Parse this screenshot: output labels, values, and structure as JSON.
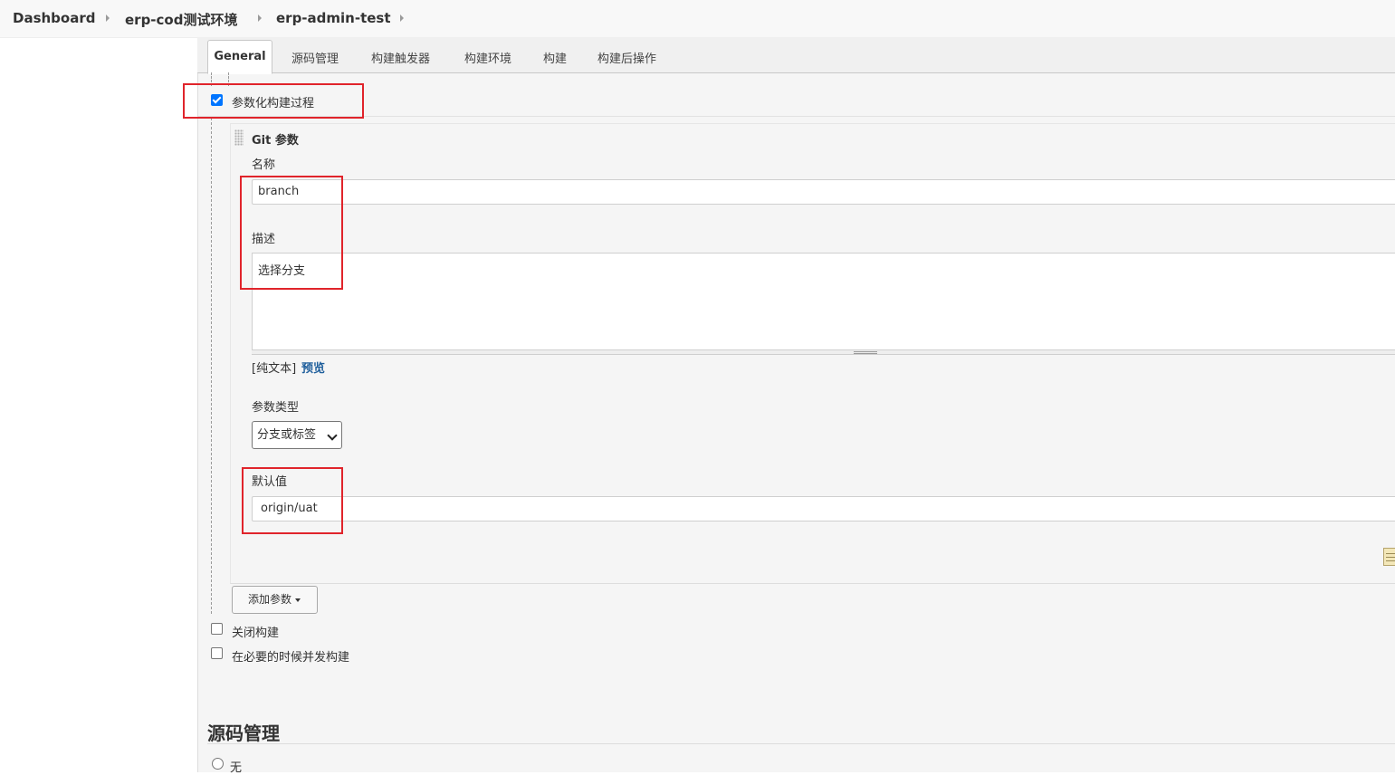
{
  "breadcrumb": {
    "items": [
      "Dashboard",
      "erp-cod测试环境",
      "erp-admin-test"
    ]
  },
  "tabs": {
    "active": "General",
    "items": [
      "源码管理",
      "构建触发器",
      "构建环境",
      "构建",
      "构建后操作"
    ]
  },
  "general": {
    "parameterized_label": "参数化构建过程",
    "parameterized_checked": true,
    "git_param": {
      "title": "Git 参数",
      "name_label": "名称",
      "name_value": "branch",
      "description_label": "描述",
      "description_value": "选择分支",
      "plain_text_label": "[纯文本]",
      "preview_label": "预览",
      "type_label": "参数类型",
      "type_value": "分支或标签",
      "default_label": "默认值",
      "default_value": "origin/uat"
    },
    "add_param_label": "添加参数",
    "disable_build_label": "关闭构建",
    "disable_build_checked": false,
    "concurrent_build_label": "在必要的时候并发构建",
    "concurrent_build_checked": false
  },
  "scm": {
    "heading": "源码管理",
    "none_label": "无"
  },
  "colors": {
    "highlight_box": "#e0242b",
    "checkbox_checked": "#0075ff",
    "link": "#1f5f9c"
  }
}
